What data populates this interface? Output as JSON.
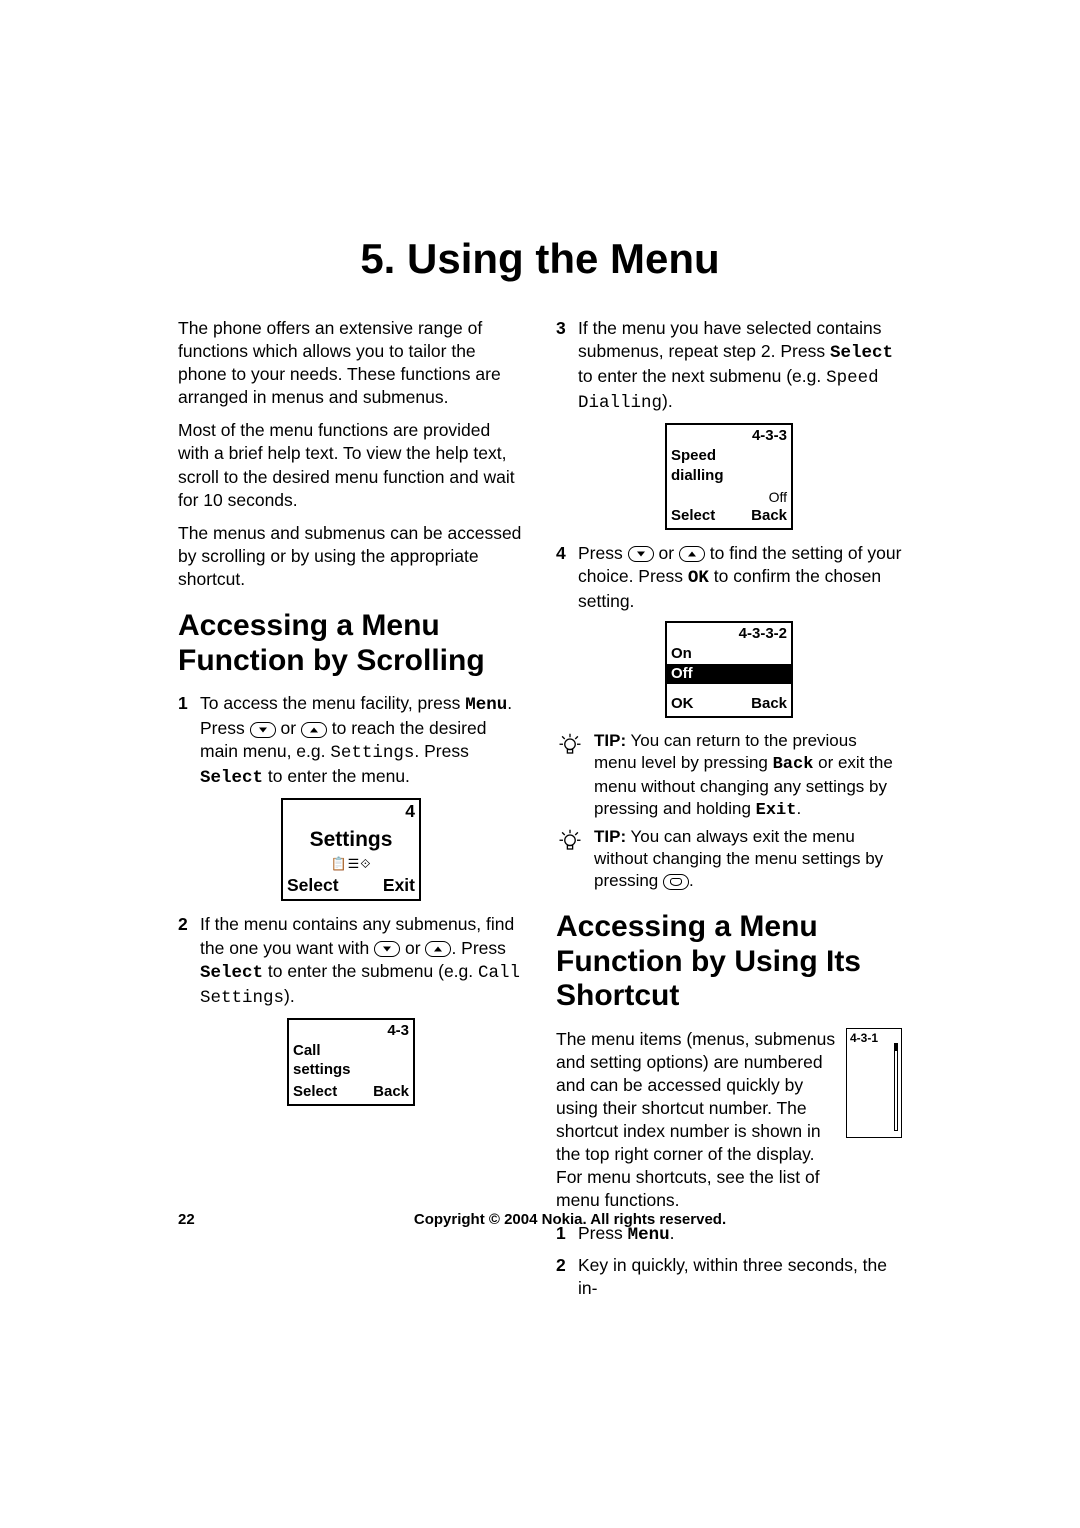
{
  "chapter_title": "5. Using the Menu",
  "left": {
    "intro": [
      "The phone offers an extensive range of functions which allows you to tailor the phone to your needs. These functions are arranged in menus and submenus.",
      "Most of the menu functions are provided with a brief help text. To view the help text, scroll to the desired menu function and wait for 10 seconds.",
      "The menus and submenus can be accessed by scrolling or by using the appropriate shortcut."
    ],
    "h2": "Accessing a Menu Function by Scrolling",
    "steps": {
      "s1": {
        "pre": "To access the menu facility, press ",
        "menu": "Menu",
        "mid1": ". Press ",
        "mid2": " or ",
        "mid3": " to reach the desired main menu, e.g. ",
        "settings": "Settings",
        "mid4": ". Press ",
        "select": "Select",
        "post": " to enter the menu."
      },
      "s2": {
        "pre": "If the menu contains any submenus, find the one you want with ",
        "mid1": " or ",
        "mid2": ". Press ",
        "select": "Select",
        "mid3": " to enter the submenu (e.g. ",
        "callset": "Call Set­tings",
        "post": ")."
      }
    },
    "screen1": {
      "idx": "4",
      "title": "Settings",
      "icons": "📋☰⟐",
      "left": "Select",
      "right": "Exit"
    },
    "screen2": {
      "idx": "4-3",
      "title1": "Call",
      "title2": "settings",
      "left": "Select",
      "right": "Back"
    }
  },
  "right": {
    "s3": {
      "num": "3",
      "pre": "If the menu you have selected contains sub­menus, repeat step 2. Press ",
      "select": "Select",
      "mid": " to enter the next submenu (e.g. ",
      "sd": "Speed Dial­ling",
      "post": ")."
    },
    "screen3": {
      "idx": "4-3-3",
      "title1": "Speed",
      "title2": "dialling",
      "off": "Off",
      "left": "Select",
      "right": "Back"
    },
    "s4": {
      "num": "4",
      "pre": "Press ",
      "mid1": " or ",
      "mid2": " to find the setting of your choice. Press ",
      "ok": "OK",
      "post": " to confirm the chosen set­ting."
    },
    "screen4": {
      "idx": "4-3-3-2",
      "on": "On",
      "off": "Off",
      "left": "OK",
      "right": "Back"
    },
    "tip1": {
      "label": "TIP:",
      "t1": " You can return to the previous menu level by pressing ",
      "back": "Back",
      "t2": " or exit the menu without changing any set­tings by pressing and holding ",
      "exit": "Exit",
      "t3": "."
    },
    "tip2": {
      "label": "TIP:",
      "t1": " You can always exit the menu without changing the menu settings by pressing ",
      "t2": "."
    },
    "h2b": "Accessing a Menu Function by Using Its Shortcut",
    "short_idx": "4-3-1",
    "short_intro": "The menu items (menus, submenus and setting options) are numbered and can be accessed quickly by using their shortcut number. The shortcut index number is shown in the top right cor­ner of the display. For menu shortcuts, see the list of menu functions.",
    "short_steps": {
      "s1": {
        "pre": "Press ",
        "menu": "Menu",
        "post": "."
      },
      "s2": "Key in quickly, within three seconds, the in-"
    }
  },
  "footer": {
    "page": "22",
    "copyright": "Copyright © 2004 Nokia. All rights reserved."
  }
}
